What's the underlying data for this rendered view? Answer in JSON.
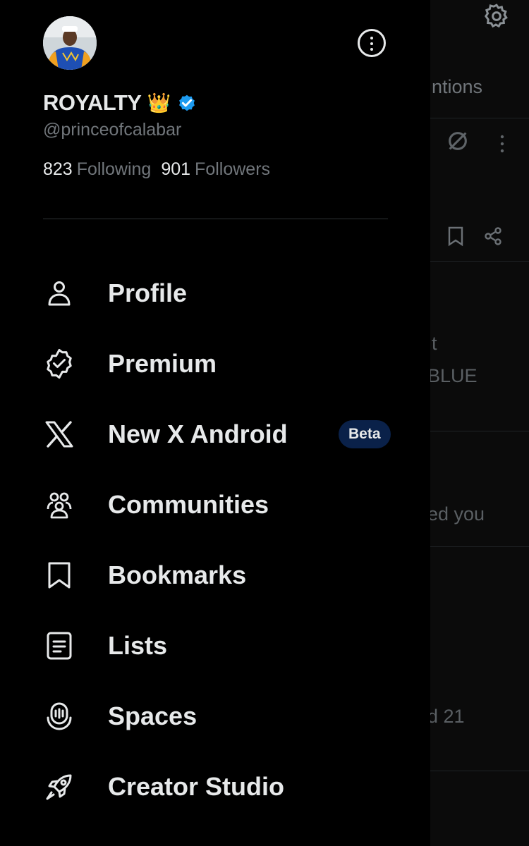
{
  "background": {
    "tab_fragment": "ntions",
    "item1_text_line1": "t",
    "item1_text_line2": "BLUE",
    "item2_text": "ed you",
    "item3_text": "d 21",
    "icons": [
      "gear-icon",
      "no-signal-icon",
      "more-vertical-icon",
      "bookmark-icon",
      "share-icon"
    ]
  },
  "profile": {
    "display_name": "ROYALTY",
    "emoji": "👑",
    "handle": "@princeofcalabar",
    "following_count": "823",
    "following_label": "Following",
    "followers_count": "901",
    "followers_label": "Followers"
  },
  "menu": [
    {
      "label": "Profile",
      "icon": "person-icon"
    },
    {
      "label": "Premium",
      "icon": "verified-badge-icon"
    },
    {
      "label": "New X Android",
      "icon": "x-logo-icon",
      "badge": "Beta"
    },
    {
      "label": "Communities",
      "icon": "communities-icon"
    },
    {
      "label": "Bookmarks",
      "icon": "bookmark-icon"
    },
    {
      "label": "Lists",
      "icon": "list-icon"
    },
    {
      "label": "Spaces",
      "icon": "spaces-icon"
    },
    {
      "label": "Creator Studio",
      "icon": "rocket-icon"
    }
  ],
  "colors": {
    "background": "#000000",
    "text_primary": "#e7e9ea",
    "text_secondary": "#71767b",
    "verified_blue": "#1d9bf0",
    "beta_badge_bg": "#0a2149"
  }
}
